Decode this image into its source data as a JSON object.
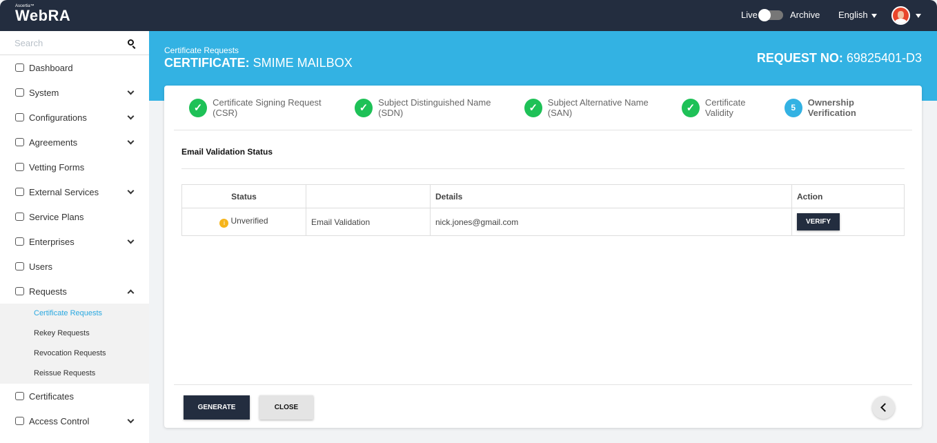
{
  "header": {
    "brand_small": "Ascertia™",
    "brand": "WebRA",
    "live": "Live",
    "archive": "Archive",
    "language": "English"
  },
  "sidebar": {
    "search_placeholder": "Search",
    "items": [
      {
        "label": "Dashboard",
        "chev": false
      },
      {
        "label": "System",
        "chev": true
      },
      {
        "label": "Configurations",
        "chev": true
      },
      {
        "label": "Agreements",
        "chev": true
      },
      {
        "label": "Vetting Forms",
        "chev": false
      },
      {
        "label": "External Services",
        "chev": true
      },
      {
        "label": "Service Plans",
        "chev": false
      },
      {
        "label": "Enterprises",
        "chev": true
      },
      {
        "label": "Users",
        "chev": false
      },
      {
        "label": "Requests",
        "chev": true
      }
    ],
    "sub": [
      "Certificate Requests",
      "Rekey Requests",
      "Revocation Requests",
      "Reissue Requests"
    ],
    "after": [
      {
        "label": "Certificates"
      },
      {
        "label": "Access Control"
      }
    ]
  },
  "banner": {
    "crumb": "Certificate Requests",
    "title_prefix": "CERTIFICATE:",
    "title": "SMIME MAILBOX",
    "req_prefix": "REQUEST NO:",
    "req": "69825401-D3"
  },
  "steps": [
    {
      "label": "Certificate Signing Request (CSR)",
      "mark": "✓"
    },
    {
      "label": "Subject Distinguished Name (SDN)",
      "mark": "✓"
    },
    {
      "label": "Subject Alternative Name (SAN)",
      "mark": "✓"
    },
    {
      "label": "Certificate Validity",
      "mark": "✓"
    },
    {
      "label": "Ownership Verification",
      "mark": "5"
    }
  ],
  "section": "Email Validation Status",
  "table": {
    "headers": [
      "Status",
      "",
      "Details",
      "Action"
    ],
    "row": {
      "status": "Unverified",
      "type": "Email Validation",
      "details": "nick.jones@gmail.com",
      "action": "VERIFY"
    }
  },
  "buttons": {
    "generate": "GENERATE",
    "close": "CLOSE"
  }
}
